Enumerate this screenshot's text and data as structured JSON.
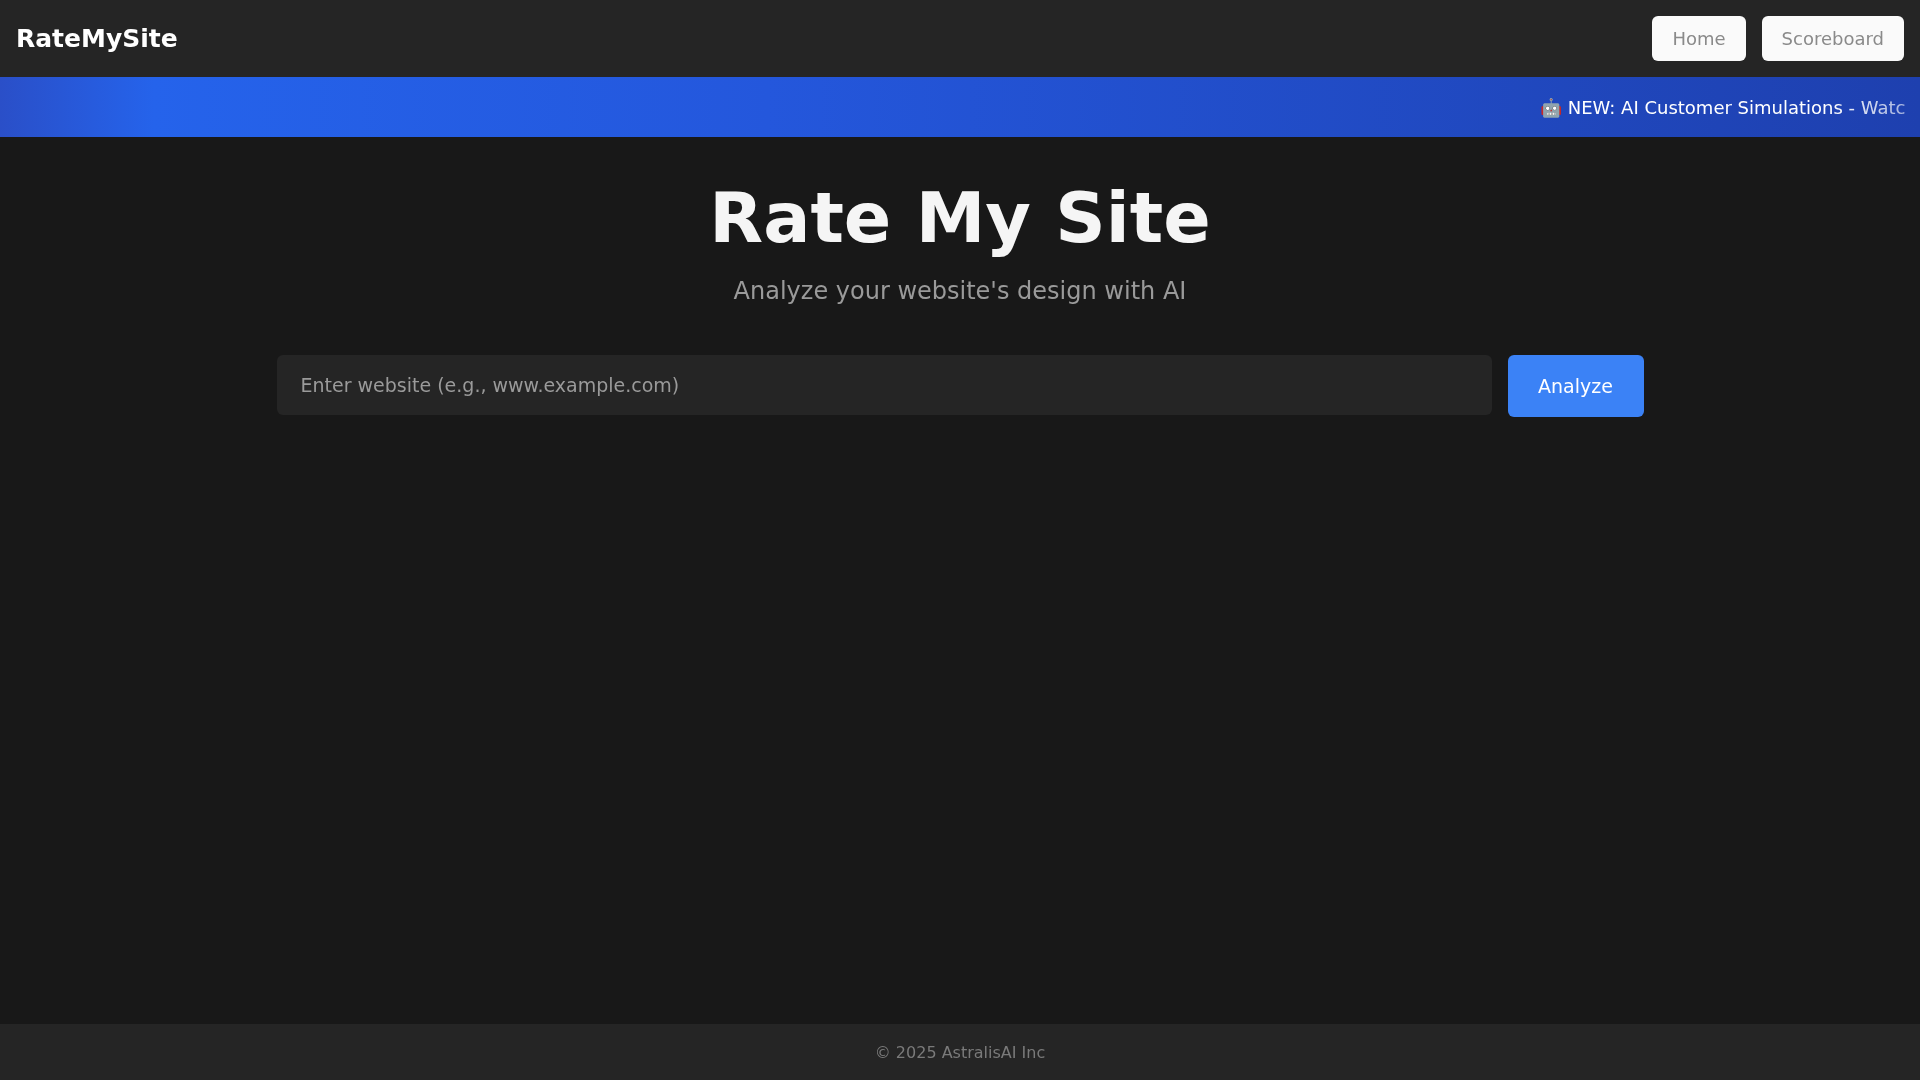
{
  "header": {
    "brand": "RateMySite",
    "nav": [
      {
        "label": "Home"
      },
      {
        "label": "Scoreboard"
      }
    ]
  },
  "banner": {
    "text": "🤖 NEW: AI Customer Simulations - Watc"
  },
  "hero": {
    "title": "Rate My Site",
    "subtitle": "Analyze your website's design with AI"
  },
  "search": {
    "placeholder": "Enter website (e.g., www.example.com)",
    "button": "Analyze"
  },
  "footer": {
    "text": "© 2025 AstralisAI Inc"
  }
}
